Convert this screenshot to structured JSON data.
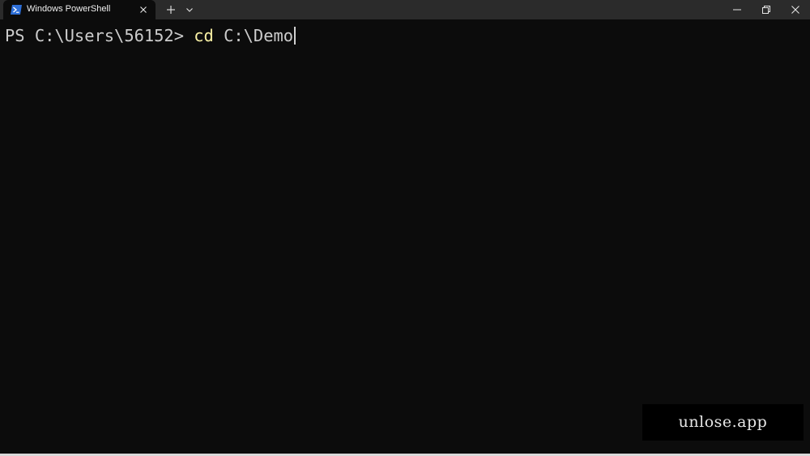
{
  "window": {
    "tab_title": "Windows PowerShell"
  },
  "terminal": {
    "prompt": "PS C:\\Users\\56152> ",
    "command": "cd",
    "argument": " C:\\Demo"
  },
  "watermark": {
    "text": "unlose.app"
  },
  "colors": {
    "titlebar_bg": "#2b2b2b",
    "terminal_bg": "#0c0c0c",
    "command_yellow": "#f9f1a5",
    "text": "#cccccc"
  },
  "icons": {
    "tab_icon": "powershell-icon",
    "tab_close": "close-icon",
    "new_tab": "plus-icon",
    "dropdown": "chevron-down-icon",
    "minimize": "minimize-icon",
    "maximize": "restore-icon",
    "close": "close-icon"
  }
}
